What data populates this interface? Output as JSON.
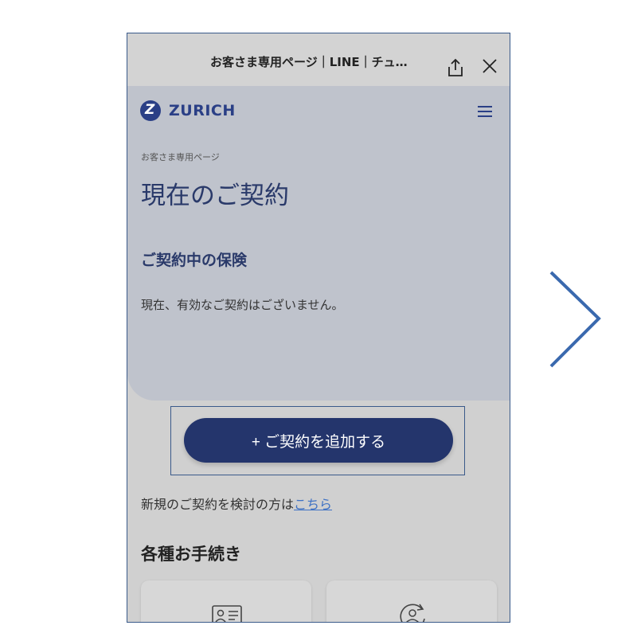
{
  "topbar": {
    "title": "お客さま専用ページ｜LINE｜チュ…"
  },
  "brand": {
    "name": "ZURICH"
  },
  "page": {
    "breadcrumb": "お客さま専用ページ",
    "title": "現在のご契約",
    "section_title": "ご契約中の保険",
    "no_contract_message": "現在、有効なご契約はございません。"
  },
  "actions": {
    "add_contract_label": "+ ご契約を追加する",
    "new_contract_text": "新規のご契約を検討の方は",
    "new_contract_link": "こちら"
  },
  "procedures": {
    "title": "各種お手続き"
  },
  "icons": [
    "share-icon",
    "close-icon",
    "menu-icon",
    "id-card-icon",
    "user-refresh-icon",
    "chevron-right-icon"
  ],
  "colors": {
    "primary": "#24356c",
    "hero_bg": "#bfc3cc",
    "link": "#3f72c4"
  }
}
